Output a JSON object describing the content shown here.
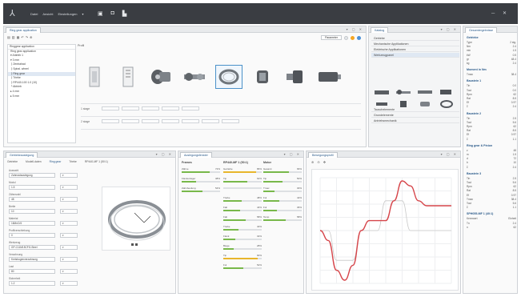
{
  "topbar": {
    "logo_glyph": "⅄",
    "menu": [
      "Datei",
      "Ansicht",
      "Einstellungen",
      "▾"
    ],
    "icons": [
      "save-icon",
      "print-icon",
      "export-icon"
    ],
    "window_controls": "─ ✕"
  },
  "gear_pane": {
    "tab": "Ring gear application",
    "tree_search": "Ringgear application",
    "tree": [
      "Ring gear application",
      "▾ Antrieb 1",
      "  ▾ 3 mm",
      "    ├ Zentralrad",
      "    ├ Spiral. wheel",
      "    ├ Ring gear",
      "    ├ Triebe",
      "    ├ RP440-100 1.0 (10)",
      "    └ Abtrieb",
      "  ▸ 4 mm",
      "  ▸ 5 mm"
    ],
    "selected_tree_index": 5,
    "stage_head": "Profil",
    "lanes": [
      "1 stage",
      "2 stage"
    ],
    "toolbar_right_label": "Parameter"
  },
  "catalog_pane": {
    "tab": "Katalog",
    "items": [
      "Getriebe",
      "Mechanische Applikationen",
      "Elektrische Applikationen",
      "Werkzeugpanel",
      "",
      "",
      "",
      "",
      "",
      "Tauschelemente",
      "Grundelemente",
      "Antriebsmechanik"
    ],
    "selected_index": 3
  },
  "results_pane": {
    "tab": "Gesamtergebnisse",
    "sections": [
      {
        "title": "Getriebe",
        "rows": [
          [
            "Type",
            "2 stg."
          ],
          [
            "Nm",
            "2.4"
          ],
          [
            "min",
            "1.5"
          ],
          [
            "kW",
            "0.5"
          ],
          [
            "gr",
            "48.4"
          ],
          [
            "kg",
            "2.4"
          ]
        ]
      },
      {
        "title": "Moment in Nm",
        "rows": [
          [
            "Tmax",
            "38.4"
          ]
        ]
      },
      {
        "title": "Baustein 1",
        "rows": [
          [
            "Tin",
            "0.0"
          ],
          [
            "Tout",
            "0.0"
          ],
          [
            "Rpm",
            "62"
          ],
          [
            "Rat",
            "8.5"
          ],
          [
            "Ef",
            "0.97"
          ],
          [
            "Σ",
            "2.4"
          ]
        ]
      },
      {
        "title": "Baustein 2",
        "rows": [
          [
            "Tin",
            "2.5"
          ],
          [
            "Tout",
            "5.6"
          ],
          [
            "Rpm",
            "62"
          ],
          [
            "Rat",
            "8.5"
          ],
          [
            "Ef",
            "0.97"
          ],
          [
            "Σ",
            "1.1"
          ]
        ]
      },
      {
        "title": "Ring gear & Pinion",
        "rows": [
          [
            "z",
            "48"
          ],
          [
            "m",
            "1.5"
          ],
          [
            "d",
            "72"
          ],
          [
            "b",
            "10"
          ],
          [
            "Σ",
            "2.4"
          ]
        ]
      },
      {
        "title": "Baustein 3",
        "rows": [
          [
            "Tin",
            "2.5"
          ],
          [
            "Tout",
            "5.6"
          ],
          [
            "Rpm",
            "62"
          ],
          [
            "Rat",
            "8.5"
          ],
          [
            "Ef",
            "0.97"
          ],
          [
            "Tmax",
            "38.4"
          ],
          [
            "Tout",
            "5.6"
          ],
          [
            "Σ",
            "1.1"
          ]
        ]
      },
      {
        "title": "SPH055-MF 1 (40:1)",
        "rows": [
          [
            "Kennwert",
            "Einheit"
          ],
          [
            "Tn",
            "2.4"
          ],
          [
            "n",
            "62"
          ]
        ]
      }
    ]
  },
  "compass_pane": {
    "tab": "Getriebeauslegung",
    "tabs": [
      "Getriebe",
      "Modell-daten",
      "Ring gear",
      "Triebe",
      "RP440-MF 1 (50:1)"
    ],
    "fields": [
      {
        "label": "Auswahl",
        "value": "Zahnradauslegung"
      },
      {
        "label": "Modul",
        "value": "1.5"
      },
      {
        "label": "Zähnezahl",
        "value": "48"
      },
      {
        "label": "Breite",
        "value": "10"
      },
      {
        "label": "Material",
        "value": "16MnCr5"
      },
      {
        "label": "Profilverschiebung",
        "value": "0"
      },
      {
        "label": "Werkzeug",
        "value": "GP-C11M15CFG-Steel"
      },
      {
        "label": "Verzahnung",
        "value": "Kreisbogenverzahnung"
      },
      {
        "label": "Last",
        "value": "80"
      },
      {
        "label": "Sicherheit",
        "value": "1.2"
      }
    ]
  },
  "eval_pane": {
    "tab": "Auslegungsfenster",
    "columns": [
      {
        "title": "Frames",
        "items": [
          {
            "label": "Zähne",
            "pct": 72,
            "color": "#78b84a"
          },
          {
            "label": "Flankenlager",
            "pct": 38,
            "color": "#78b84a"
          },
          {
            "label": "Zahnbeulung",
            "pct": 54,
            "color": "#78b84a"
          }
        ]
      },
      {
        "title": "RP440-MF 1 (50:1)",
        "items": [
          {
            "label": "Getriebe",
            "pct": 86,
            "color": "#e8b62c"
          },
          {
            "label": "Tip",
            "pct": 62,
            "color": "#78b84a"
          },
          {
            "label": "",
            "pct": 0,
            "color": "#78b84a"
          },
          {
            "label": "Triebe",
            "pct": 48,
            "color": "#78b84a"
          },
          {
            "label": "Fab",
            "pct": 44,
            "color": "#78b84a"
          },
          {
            "label": "Fab",
            "pct": 58,
            "color": "#78b84a"
          },
          {
            "label": "Triebe",
            "pct": 40,
            "color": "#78b84a"
          },
          {
            "label": "Flank",
            "pct": 32,
            "color": "#78b84a"
          },
          {
            "label": "Biege",
            "pct": 28,
            "color": "#78b84a"
          },
          {
            "label": "Tip",
            "pct": 90,
            "color": "#e8b62c"
          },
          {
            "label": "Ful",
            "pct": 52,
            "color": "#78b84a"
          }
        ]
      },
      {
        "title": "Motor",
        "items": [
          {
            "label": "Gesamt",
            "pct": 66,
            "color": "#78b84a"
          },
          {
            "label": "Tip",
            "pct": 50,
            "color": "#78b84a"
          },
          {
            "label": "Tmax",
            "pct": 30,
            "color": "#78b84a"
          },
          {
            "label": "Ful",
            "pct": 42,
            "color": "#78b84a"
          },
          {
            "label": "Ful",
            "pct": 36,
            "color": "#78b84a"
          },
          {
            "label": "Temp",
            "pct": 58,
            "color": "#78b84a"
          }
        ]
      }
    ]
  },
  "plot_pane": {
    "tab": "Bewegungsprofil"
  },
  "chart_data": {
    "type": "line",
    "title": "",
    "xlabel": "",
    "ylabel": "",
    "series": [
      {
        "values": [
          0,
          -0.2,
          -0.8,
          -1.0,
          -0.7,
          0.0,
          0.2,
          0.2,
          0.2,
          0.6,
          1.0,
          0.9,
          0.6,
          0.5,
          0.5,
          0.5,
          0.5
        ],
        "color": "#d6454a"
      },
      {
        "values": [
          0,
          0,
          -0.6,
          -0.6,
          -0.6,
          0.0,
          0.0,
          0.0,
          0.6,
          0.6,
          0.6,
          0.0,
          0.0,
          0.0,
          0.0,
          0.0,
          0.0
        ],
        "color": "#c8c8c8"
      }
    ],
    "grid": true
  }
}
